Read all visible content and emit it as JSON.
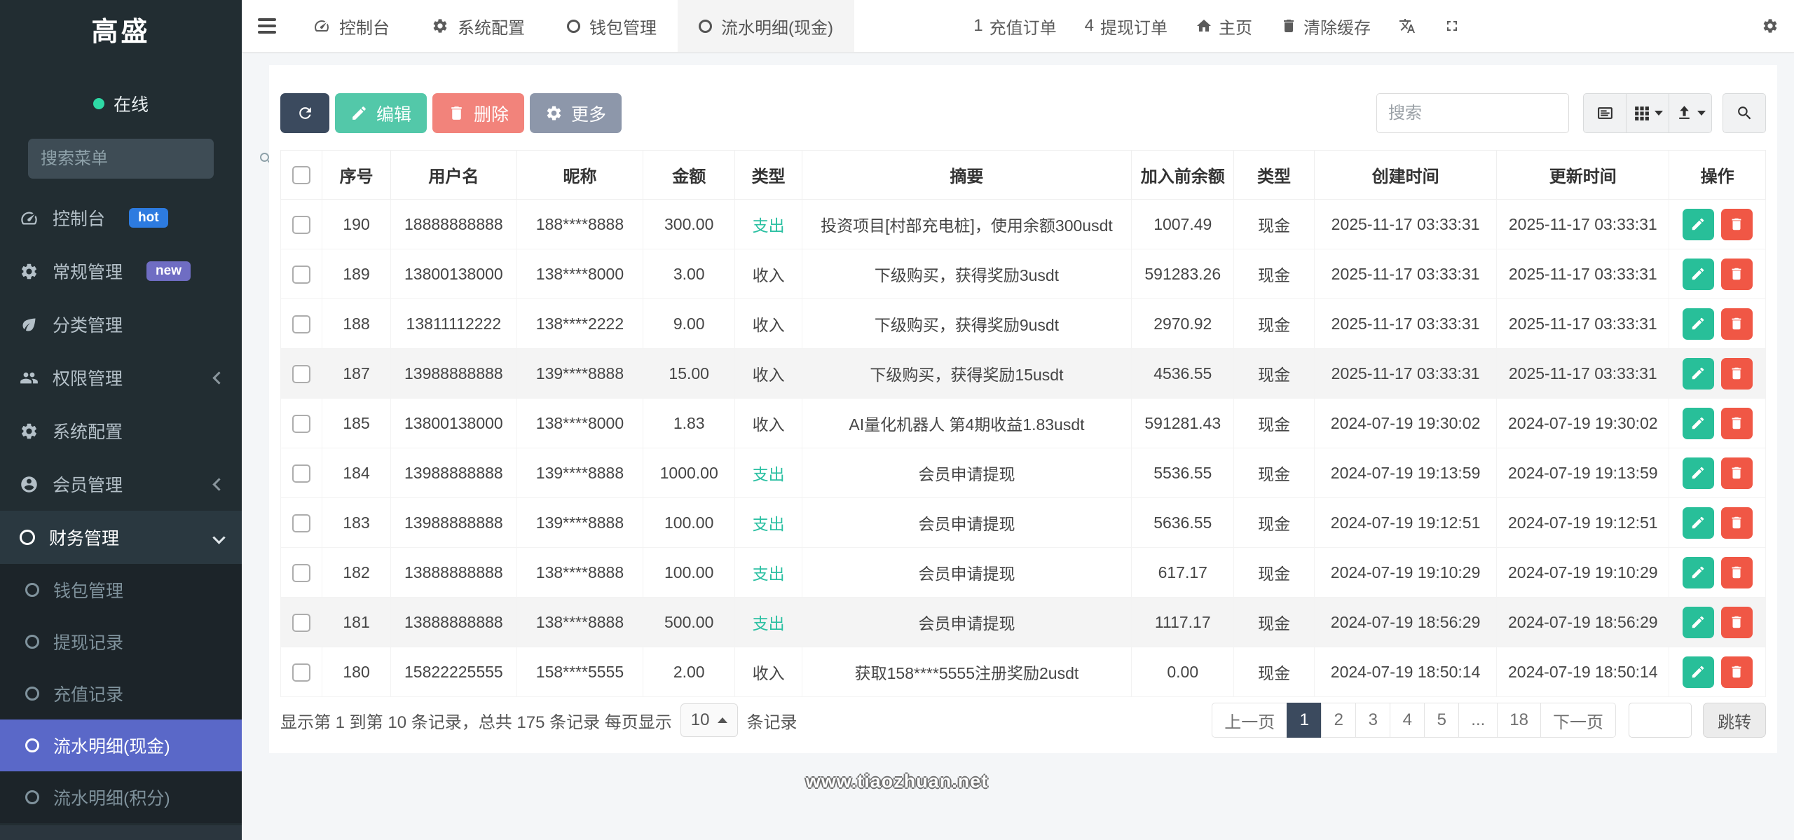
{
  "app": {
    "brand": "高盛",
    "status": "在线",
    "menu_search_placeholder": "搜索菜单",
    "watermark": "www.tiaozhuan.net"
  },
  "colors": {
    "sidebar_bg": "#222d32",
    "submenu_bg": "#1c2429",
    "active_menu_bg": "#5a68c8",
    "online_dot": "#2ed9a5",
    "badge_hot": "#2d7be0",
    "badge_new": "#6f6dc3",
    "btn_refresh": "#3b4a5e",
    "btn_edit": "#53c8a9",
    "btn_delete": "#f2837b",
    "btn_more": "#8d97aa",
    "row_edit": "#28bf99",
    "row_delete": "#f05745",
    "expense_text": "#2bc0a2",
    "income_text": "#454545",
    "pagination_active_bg": "#3b4a5e"
  },
  "sidebar": {
    "items": [
      {
        "key": "console",
        "label": "控制台",
        "icon": "dashboard-icon",
        "badge": "hot",
        "badge_color": "#2d7be0"
      },
      {
        "key": "general-management",
        "label": "常规管理",
        "icon": "cogs-icon",
        "badge": "new",
        "badge_color": "#6f6dc3"
      },
      {
        "key": "category-management",
        "label": "分类管理",
        "icon": "leaf-icon"
      },
      {
        "key": "permission-management",
        "label": "权限管理",
        "icon": "users-icon",
        "chevron": "left"
      },
      {
        "key": "system-config",
        "label": "系统配置",
        "icon": "gear-icon"
      },
      {
        "key": "member-management",
        "label": "会员管理",
        "icon": "user-icon",
        "chevron": "left"
      },
      {
        "key": "finance-management",
        "label": "财务管理",
        "icon": "ring-icon",
        "chevron": "down",
        "expanded": true
      }
    ],
    "submenu": [
      {
        "key": "wallet-management",
        "label": "钱包管理"
      },
      {
        "key": "withdraw-records",
        "label": "提现记录"
      },
      {
        "key": "recharge-records",
        "label": "充值记录"
      },
      {
        "key": "cash-flow-details",
        "label": "流水明细(现金)",
        "active": true
      },
      {
        "key": "points-flow-details",
        "label": "流水明细(积分)"
      }
    ]
  },
  "navbar": {
    "tabs": [
      {
        "key": "console",
        "label": "控制台",
        "icon": "dashboard-icon"
      },
      {
        "key": "system-config",
        "label": "系统配置",
        "icon": "gear-icon"
      },
      {
        "key": "wallet-management",
        "label": "钱包管理",
        "icon": "ring-icon"
      },
      {
        "key": "cash-flow-details",
        "label": "流水明细(现金)",
        "icon": "ring-icon",
        "active": true
      }
    ],
    "recharge_count": "1",
    "recharge_label": "充值订单",
    "withdraw_count": "4",
    "withdraw_label": "提现订单",
    "home_label": "主页",
    "clear_cache_label": "清除缓存"
  },
  "toolbar": {
    "edit_label": "编辑",
    "delete_label": "删除",
    "more_label": "更多",
    "search_placeholder": "搜索"
  },
  "table": {
    "columns": [
      {
        "key": "no",
        "label": "序号"
      },
      {
        "key": "username",
        "label": "用户名"
      },
      {
        "key": "nickname",
        "label": "昵称"
      },
      {
        "key": "amount",
        "label": "金额"
      },
      {
        "key": "type",
        "label": "类型"
      },
      {
        "key": "summary",
        "label": "摘要"
      },
      {
        "key": "balance-before",
        "label": "加入前余额"
      },
      {
        "key": "wallet-type",
        "label": "类型"
      },
      {
        "key": "created-at",
        "label": "创建时间"
      },
      {
        "key": "updated-at",
        "label": "更新时间"
      },
      {
        "key": "actions",
        "label": "操作"
      }
    ],
    "rows": [
      {
        "no": "190",
        "username": "18888888888",
        "nickname": "188****8888",
        "amount": "300.00",
        "type": "支出",
        "type_kind": "expense",
        "summary": "投资项目[村部充电桩]，使用余额300usdt",
        "balance_before": "1007.49",
        "wallet": "现金",
        "created": "2025-11-17 03:33:31",
        "updated": "2025-11-17 03:33:31",
        "shaded": false
      },
      {
        "no": "189",
        "username": "13800138000",
        "nickname": "138****8000",
        "amount": "3.00",
        "type": "收入",
        "type_kind": "income",
        "summary": "下级购买，获得奖励3usdt",
        "balance_before": "591283.26",
        "wallet": "现金",
        "created": "2025-11-17 03:33:31",
        "updated": "2025-11-17 03:33:31",
        "shaded": false
      },
      {
        "no": "188",
        "username": "13811112222",
        "nickname": "138****2222",
        "amount": "9.00",
        "type": "收入",
        "type_kind": "income",
        "summary": "下级购买，获得奖励9usdt",
        "balance_before": "2970.92",
        "wallet": "现金",
        "created": "2025-11-17 03:33:31",
        "updated": "2025-11-17 03:33:31",
        "shaded": false
      },
      {
        "no": "187",
        "username": "13988888888",
        "nickname": "139****8888",
        "amount": "15.00",
        "type": "收入",
        "type_kind": "income",
        "summary": "下级购买，获得奖励15usdt",
        "balance_before": "4536.55",
        "wallet": "现金",
        "created": "2025-11-17 03:33:31",
        "updated": "2025-11-17 03:33:31",
        "shaded": true
      },
      {
        "no": "185",
        "username": "13800138000",
        "nickname": "138****8000",
        "amount": "1.83",
        "type": "收入",
        "type_kind": "income",
        "summary": "AI量化机器人 第4期收益1.83usdt",
        "balance_before": "591281.43",
        "wallet": "现金",
        "created": "2024-07-19 19:30:02",
        "updated": "2024-07-19 19:30:02",
        "shaded": false
      },
      {
        "no": "184",
        "username": "13988888888",
        "nickname": "139****8888",
        "amount": "1000.00",
        "type": "支出",
        "type_kind": "expense",
        "summary": "会员申请提现",
        "balance_before": "5536.55",
        "wallet": "现金",
        "created": "2024-07-19 19:13:59",
        "updated": "2024-07-19 19:13:59",
        "shaded": false
      },
      {
        "no": "183",
        "username": "13988888888",
        "nickname": "139****8888",
        "amount": "100.00",
        "type": "支出",
        "type_kind": "expense",
        "summary": "会员申请提现",
        "balance_before": "5636.55",
        "wallet": "现金",
        "created": "2024-07-19 19:12:51",
        "updated": "2024-07-19 19:12:51",
        "shaded": false
      },
      {
        "no": "182",
        "username": "13888888888",
        "nickname": "138****8888",
        "amount": "100.00",
        "type": "支出",
        "type_kind": "expense",
        "summary": "会员申请提现",
        "balance_before": "617.17",
        "wallet": "现金",
        "created": "2024-07-19 19:10:29",
        "updated": "2024-07-19 19:10:29",
        "shaded": false
      },
      {
        "no": "181",
        "username": "13888888888",
        "nickname": "138****8888",
        "amount": "500.00",
        "type": "支出",
        "type_kind": "expense",
        "summary": "会员申请提现",
        "balance_before": "1117.17",
        "wallet": "现金",
        "created": "2024-07-19 18:56:29",
        "updated": "2024-07-19 18:56:29",
        "shaded": true
      },
      {
        "no": "180",
        "username": "15822225555",
        "nickname": "158****5555",
        "amount": "2.00",
        "type": "收入",
        "type_kind": "income",
        "summary": "获取158****5555注册奖励2usdt",
        "balance_before": "0.00",
        "wallet": "现金",
        "created": "2024-07-19 18:50:14",
        "updated": "2024-07-19 18:50:14",
        "shaded": false
      }
    ]
  },
  "pagination": {
    "summary_prefix": "显示第 1 到第 10 条记录，总共 175 条记录 每页显示",
    "page_size": "10",
    "summary_suffix": "条记录",
    "prev_label": "上一页",
    "next_label": "下一页",
    "pages": [
      "1",
      "2",
      "3",
      "4",
      "5",
      "...",
      "18"
    ],
    "active_page": "1",
    "jump_label": "跳转"
  }
}
